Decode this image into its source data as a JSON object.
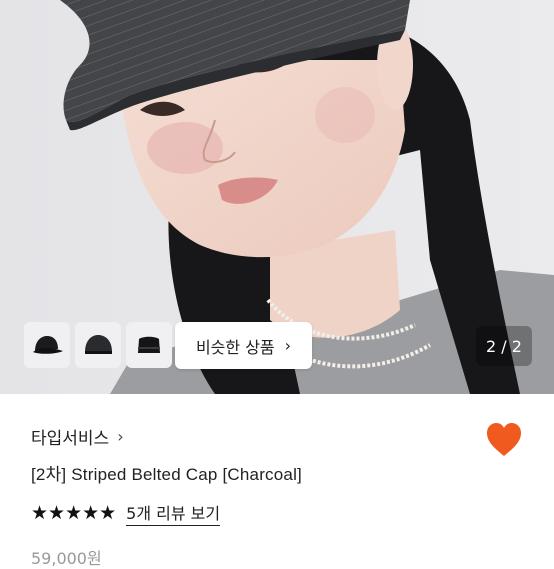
{
  "gallery": {
    "similar_label": "비슷한 상품",
    "similar_chevron": "›",
    "counter": "2 / 2",
    "thumbnails": [
      "cap-thumbnail",
      "cap-thumbnail",
      "cap-thumbnail"
    ]
  },
  "product": {
    "shop_name": "타입서비스",
    "shop_chevron": "›",
    "title": "[2차] Striped Belted Cap [Charcoal]",
    "stars": "★★★★★",
    "rating": 5,
    "review_link": "5개 리뷰 보기",
    "price": "59,000원"
  },
  "colors": {
    "heart": "#F05A1E",
    "star": "#111111",
    "counter_bg": "rgba(0,0,0,0.28)"
  },
  "icons": [
    "heart-icon",
    "star-icon",
    "chevron-right-icon",
    "cap-icon"
  ]
}
